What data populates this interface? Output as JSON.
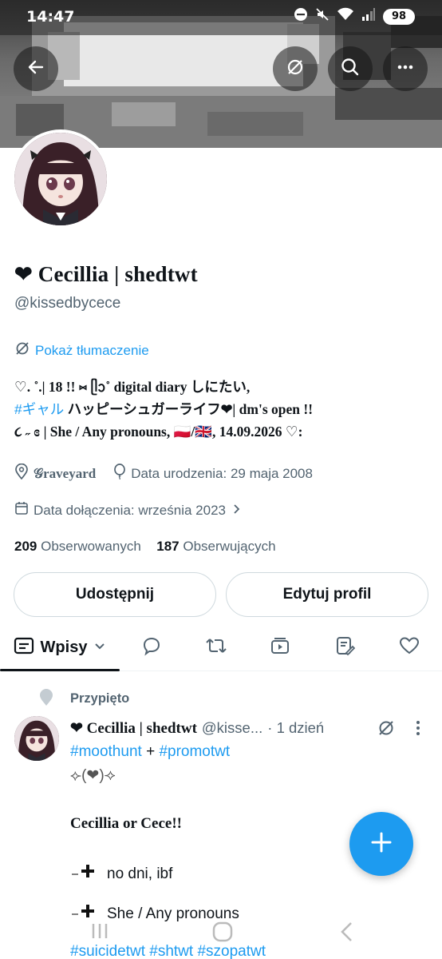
{
  "status": {
    "time": "14:47",
    "battery": "98"
  },
  "header": {
    "back_icon": "arrow-left-icon",
    "translate_icon": "translate-icon",
    "search_icon": "search-icon",
    "more_icon": "more-horizontal-icon"
  },
  "profile": {
    "name": "❤ Cecillia | shedtwt",
    "handle": "@kissedbycece",
    "translate_label": "Pokaż tłumaczenie",
    "bio": {
      "line1": "♡.  ˚.|   18 !!  ⑅ ᥫᩣ˚ digital diary しにたい,",
      "hashtag": "#ギャル",
      "line2_rest": " ハッピーシュガーライフ❤| dm's open !!",
      "line3": "૮ ˶ ɞ  | She / Any pronouns, 🇵🇱/🇬🇧, 14.09.2026 ♡:"
    },
    "location": "𝒢raveyard",
    "birthday": "Data urodzenia: 29 maja 2008",
    "joined": "Data dołączenia: września 2023",
    "following_count": "209",
    "following_label": "Obserwowanych",
    "followers_count": "187",
    "followers_label": "Obserwujących",
    "share_button": "Udostępnij",
    "edit_button": "Edytuj profil"
  },
  "tabs": {
    "active_label": "Wpisy",
    "items": [
      "posts-icon",
      "reply-icon",
      "retweet-icon",
      "media-icon",
      "articles-icon",
      "like-icon"
    ]
  },
  "pinned_tweet": {
    "pinned_label": "Przypięto",
    "name": "❤ Cecillia | shedtwt",
    "handle": "@kisse...",
    "time": "· 1 dzień",
    "hashtag1": "#moothunt",
    "plus": " + ",
    "hashtag2": "#promotwt",
    "deco": "⟣(❤)⟢",
    "intro": "Cecillia or Cece!!",
    "item1": "no dni, ibf",
    "item2": "She / Any pronouns",
    "bottom_tags": "#suicidetwt #shtwt #szopatwt"
  },
  "colors": {
    "accent": "#1d9bf0",
    "text": "#0f1419",
    "secondary": "#536471",
    "border": "#cfd9de"
  }
}
